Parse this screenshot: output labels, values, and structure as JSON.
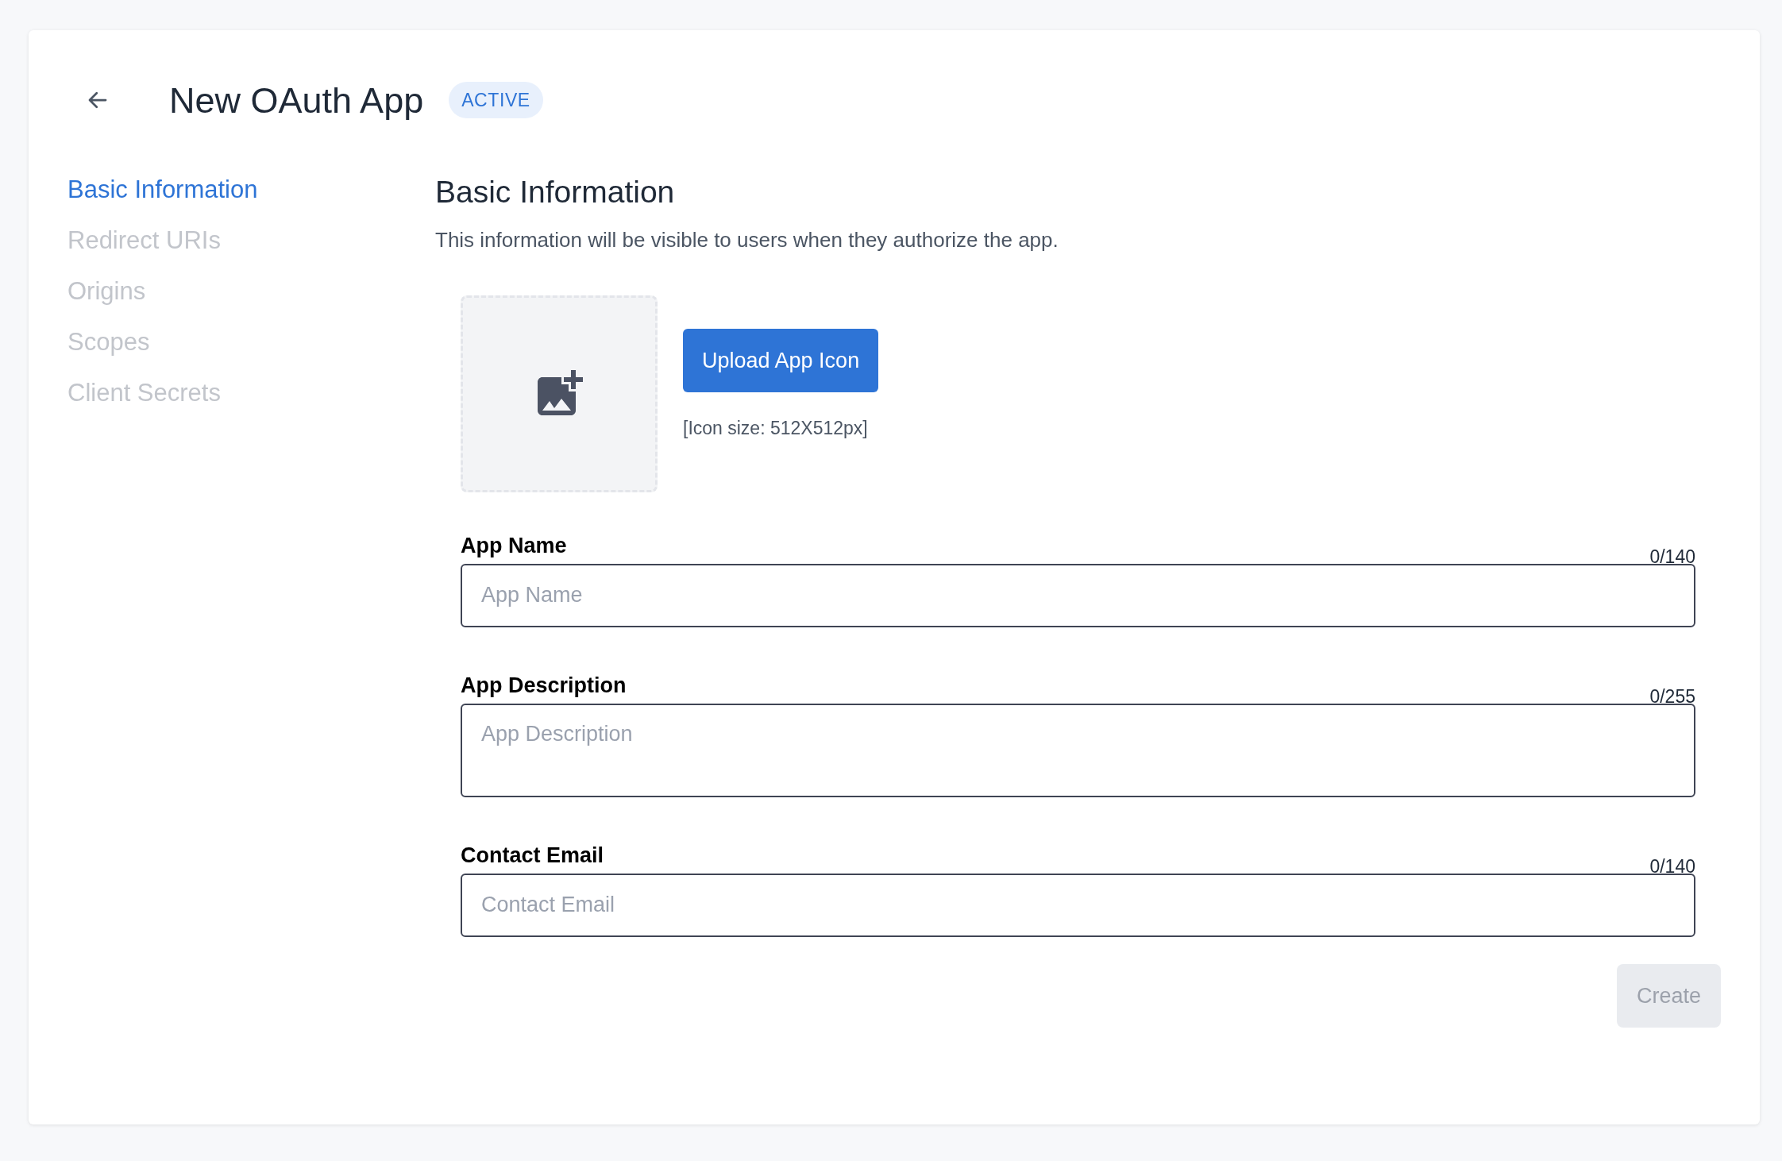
{
  "header": {
    "title": "New OAuth App",
    "status_badge": "ACTIVE"
  },
  "sidebar": {
    "items": [
      {
        "label": "Basic Information",
        "selected": true
      },
      {
        "label": "Redirect URIs",
        "selected": false
      },
      {
        "label": "Origins",
        "selected": false
      },
      {
        "label": "Scopes",
        "selected": false
      },
      {
        "label": "Client Secrets",
        "selected": false
      }
    ]
  },
  "section": {
    "title": "Basic Information",
    "description": "This information will be visible to users when they authorize the app."
  },
  "icon_upload": {
    "button": "Upload App Icon",
    "hint": "[Icon size: 512X512px]"
  },
  "fields": [
    {
      "kind": "input",
      "label": "App Name",
      "placeholder": "App Name",
      "counter": "0/140"
    },
    {
      "kind": "textarea",
      "label": "App Description",
      "placeholder": "App Description",
      "counter": "0/255"
    },
    {
      "kind": "input",
      "label": "Contact Email",
      "placeholder": "Contact Email",
      "counter": "0/140"
    }
  ],
  "create_button": {
    "label": "Create",
    "disabled": true
  }
}
